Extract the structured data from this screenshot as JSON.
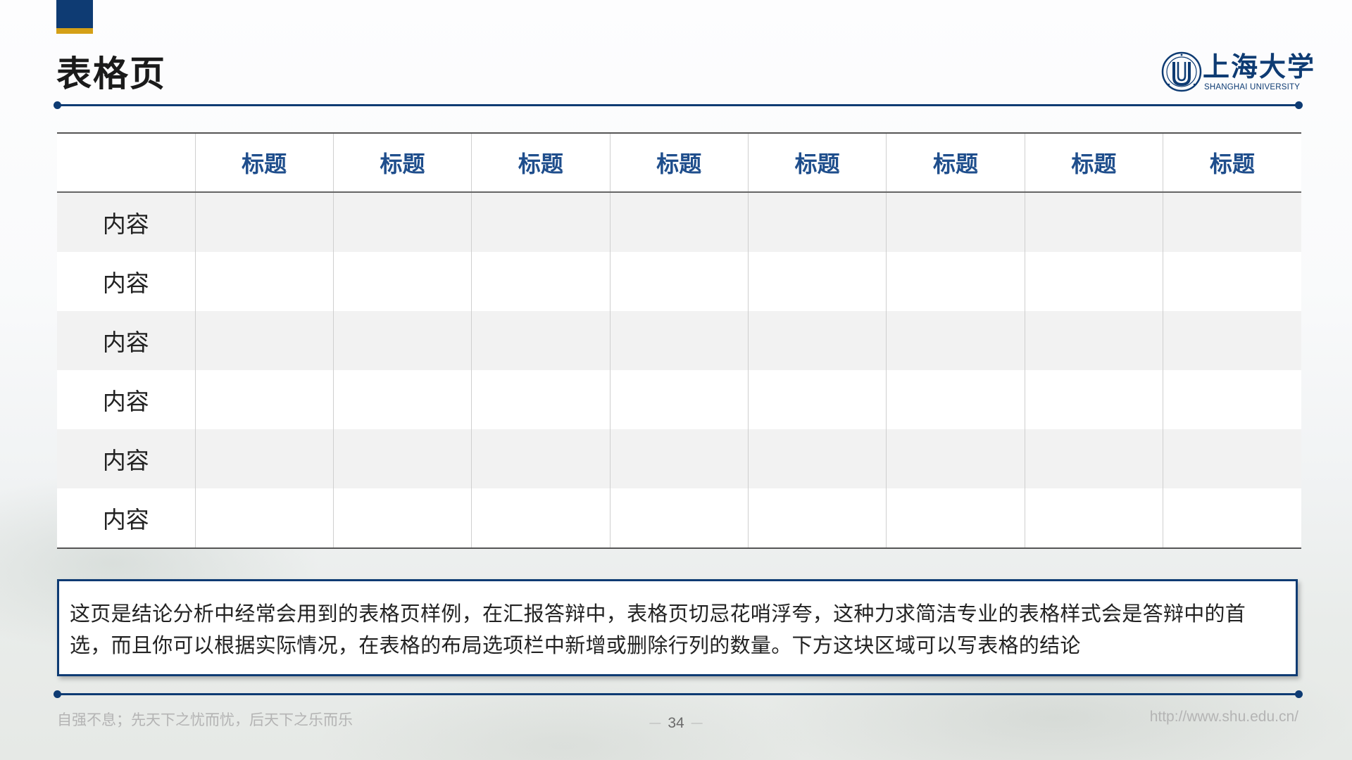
{
  "header": {
    "title": "表格页",
    "logo": {
      "name_cn": "上海大学",
      "name_en": "SHANGHAI UNIVERSITY",
      "emblem": "shanghai-university-emblem"
    }
  },
  "table": {
    "corner": "",
    "columns": [
      "标题",
      "标题",
      "标题",
      "标题",
      "标题",
      "标题",
      "标题",
      "标题"
    ],
    "rows": [
      {
        "label": "内容",
        "cells": [
          "",
          "",
          "",
          "",
          "",
          "",
          "",
          ""
        ]
      },
      {
        "label": "内容",
        "cells": [
          "",
          "",
          "",
          "",
          "",
          "",
          "",
          ""
        ]
      },
      {
        "label": "内容",
        "cells": [
          "",
          "",
          "",
          "",
          "",
          "",
          "",
          ""
        ]
      },
      {
        "label": "内容",
        "cells": [
          "",
          "",
          "",
          "",
          "",
          "",
          "",
          ""
        ]
      },
      {
        "label": "内容",
        "cells": [
          "",
          "",
          "",
          "",
          "",
          "",
          "",
          ""
        ]
      },
      {
        "label": "内容",
        "cells": [
          "",
          "",
          "",
          "",
          "",
          "",
          "",
          ""
        ]
      }
    ]
  },
  "conclusion": {
    "text": "这页是结论分析中经常会用到的表格页样例，在汇报答辩中，表格页切忌花哨浮夸，这种力求简洁专业的表格样式会是答辩中的首选，而且你可以根据实际情况，在表格的布局选项栏中新增或删除行列的数量。下方这块区域可以写表格的结论"
  },
  "footer": {
    "motto": "自强不息；先天下之忧而忧，后天下之乐而乐",
    "page_number": "34",
    "url": "http://www.shu.edu.cn/"
  },
  "colors": {
    "primary_blue": "#0e3b73",
    "accent_gold": "#d4a017",
    "header_text_blue": "#1f4e8c",
    "stripe_gray": "#f2f2f2"
  }
}
